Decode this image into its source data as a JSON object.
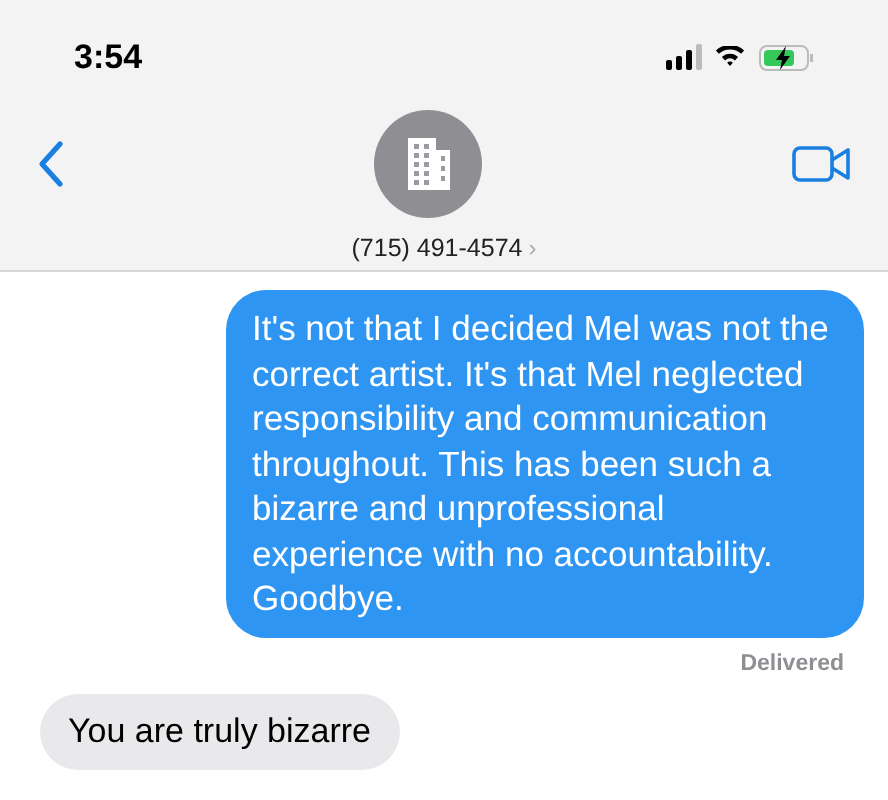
{
  "status_bar": {
    "time": "3:54"
  },
  "header": {
    "contact": "(715) 491-4574",
    "contact_chevron": "›"
  },
  "messages": [
    {
      "kind": "sent",
      "text": "It's not that I decided Mel was not the correct artist. It's that Mel neglected responsibility and communication throughout. This has been such a bizarre and unprofessional experience with no accountability. Goodbye.",
      "status": "Delivered"
    },
    {
      "kind": "received",
      "text": "You are truly bizarre"
    }
  ]
}
